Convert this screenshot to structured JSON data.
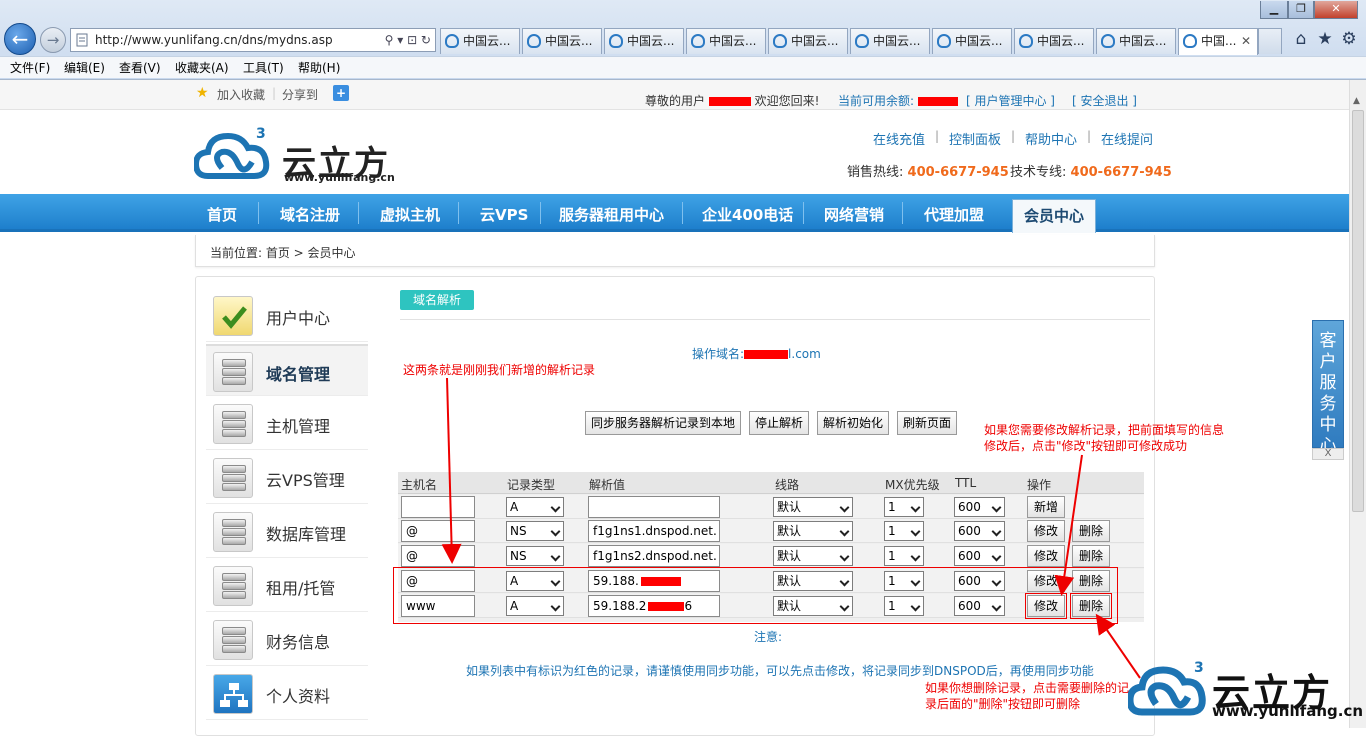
{
  "browser": {
    "address": "http://www.yunlifang.cn/dns/mydns.asp",
    "tabs": [
      "中国云...",
      "中国云...",
      "中国云...",
      "中国云...",
      "中国云...",
      "中国云...",
      "中国云...",
      "中国云...",
      "中国云...",
      "中国..."
    ],
    "menu": [
      "文件(F)",
      "编辑(E)",
      "查看(V)",
      "收藏夹(A)",
      "工具(T)",
      "帮助(H)"
    ]
  },
  "topbar": {
    "favorite": "加入收藏",
    "share": "分享到",
    "welcome_prefix": "尊敬的用户",
    "welcome_suffix": "欢迎您回来!",
    "balance": "当前可用余额:",
    "user_center": "[ 用户管理中心 ]",
    "logout": "[ 安全退出 ]"
  },
  "header": {
    "logo_text": "云立方",
    "logo_url": "www.yunlifang.cn",
    "links": [
      "在线充值",
      "控制面板",
      "帮助中心",
      "在线提问"
    ],
    "sales_label": "销售热线:",
    "sales_number": "400-6677-945",
    "tech_label": "技术专线:",
    "tech_number": "400-6677-945"
  },
  "nav": [
    "首页",
    "域名注册",
    "虚拟主机",
    "云VPS",
    "服务器租用中心",
    "企业400电话",
    "网络营销",
    "代理加盟",
    "会员中心"
  ],
  "breadcrumb": "当前位置: 首页 > 会员中心",
  "sidebar": [
    "用户中心",
    "域名管理",
    "主机管理",
    "云VPS管理",
    "数据库管理",
    "租用/托管",
    "财务信息",
    "个人资料"
  ],
  "panel": {
    "tab": "域名解析",
    "domain_label": "操作域名:",
    "domain_suffix": "l.com",
    "buttons": [
      "同步服务器解析记录到本地",
      "停止解析",
      "解析初始化",
      "刷新页面"
    ],
    "columns": [
      "主机名",
      "记录类型",
      "解析值",
      "线路",
      "MX优先级",
      "TTL",
      "操作"
    ],
    "rows": [
      {
        "host": "",
        "type": "A",
        "value": "",
        "line": "默认",
        "mx": "1",
        "ttl": "600",
        "actions": [
          "新增"
        ]
      },
      {
        "host": "@",
        "type": "NS",
        "value": "f1g1ns1.dnspod.net.",
        "line": "默认",
        "mx": "1",
        "ttl": "600",
        "actions": [
          "修改",
          "删除"
        ]
      },
      {
        "host": "@",
        "type": "NS",
        "value": "f1g1ns2.dnspod.net.",
        "line": "默认",
        "mx": "1",
        "ttl": "600",
        "actions": [
          "修改",
          "删除"
        ]
      },
      {
        "host": "@",
        "type": "A",
        "value": "59.188.",
        "line": "默认",
        "mx": "1",
        "ttl": "600",
        "actions": [
          "修改",
          "删除"
        ]
      },
      {
        "host": "www",
        "type": "A",
        "value": "59.188.2",
        "value_tail": "6",
        "line": "默认",
        "mx": "1",
        "ttl": "600",
        "actions": [
          "修改",
          "删除"
        ]
      }
    ],
    "note_title": "注意:",
    "note_body": "如果列表中有标识为红色的记录，请谨慎使用同步功能，可以先点击修改，将记录同步到DNSPOD后，再使用同步功能"
  },
  "annotations": {
    "new_records": "这两条就是刚刚我们新增的解析记录",
    "modify_hint": "如果您需要修改解析记录，把前面填写的信息修改后，点击\"修改\"按钮即可修改成功",
    "delete_hint": "如果你想删除记录，点击需要删除的记录后面的\"删除\"按钮即可删除"
  },
  "side_panel": {
    "label": "客户服务中心",
    "close": "X"
  },
  "watermark": {
    "text": "云立方",
    "url": "www.yunlifang.cn"
  },
  "colors": {
    "nav": "#1e7fcc",
    "link": "#1d74b3",
    "accent": "#f06a1c",
    "annotation": "#ee0000",
    "teal": "#2ec4c0"
  }
}
